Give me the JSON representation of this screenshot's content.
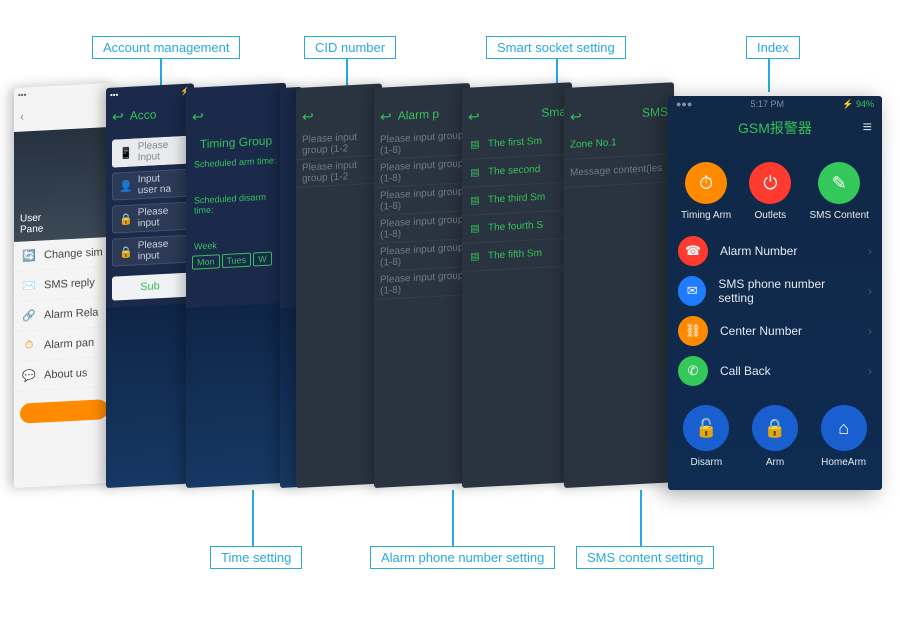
{
  "labels": {
    "top": [
      "Account management",
      "CID number",
      "Smart socket setting",
      "Index"
    ],
    "bottom": [
      "Time setting",
      "Alarm phone number setting",
      "SMS content setting"
    ]
  },
  "phone1_settings": {
    "hero_line1": "User",
    "hero_line2": "Pane",
    "items": [
      {
        "icon": "🔄",
        "color": "#ff8a00",
        "text": "Change sim"
      },
      {
        "icon": "✉️",
        "color": "#2aa9e0",
        "text": "SMS reply"
      },
      {
        "icon": "🔗",
        "color": "#ff8a00",
        "text": "Alarm Rela"
      },
      {
        "icon": "⏱",
        "color": "#ff8a00",
        "text": "Alarm pan"
      },
      {
        "icon": "💬",
        "color": "#2aa9e0",
        "text": "About us"
      }
    ]
  },
  "phone2_account": {
    "title": "Acco",
    "inputs": [
      {
        "icon": "📱",
        "ph": "Please Input"
      },
      {
        "icon": "👤",
        "ph": "Input user na"
      },
      {
        "icon": "🔒",
        "ph": "Please input"
      },
      {
        "icon": "🔒",
        "ph": "Please input"
      }
    ],
    "submit": "Sub"
  },
  "phone3_timing": {
    "title": "Timing Group",
    "arm_label": "Scheduled arm time:",
    "disarm_label": "Scheduled disarm time:",
    "week_label": "Week",
    "days": [
      "Mon",
      "Tues",
      "W"
    ]
  },
  "phone4_cid": {
    "placeholder": "Please input group (1-2"
  },
  "phone5_cid2": {
    "placeholder": "Please input group (1-8)"
  },
  "phone6_alarm": {
    "title": "Alarm p",
    "rows": [
      "Please input group (1-8)",
      "Please input group (1-8)",
      "Please input group (1-8)",
      "Please input group (1-8)",
      "Please input group (1-8)",
      "Please input group (1-8)"
    ]
  },
  "phone7_socket": {
    "title": "Sma",
    "rows": [
      "The first Sm",
      "The second",
      "The third Sm",
      "The fourth S",
      "The fifth Sm"
    ]
  },
  "phone8_sms": {
    "title": "SMS",
    "zone": "Zone No.1",
    "msg": "Message content(les"
  },
  "phone10_index": {
    "status": {
      "left": "●●●",
      "time": "5:17 PM",
      "batt": "94%"
    },
    "title": "GSM报警器",
    "top_circles": [
      {
        "cls": "c-or",
        "glyph": "⏱",
        "label": "Timing Arm"
      },
      {
        "cls": "c-rd",
        "glyph": "⏻",
        "label": "Outlets"
      },
      {
        "cls": "c-gr",
        "glyph": "✎",
        "label": "SMS Content"
      }
    ],
    "list": [
      {
        "cls": "c-rd",
        "glyph": "☎",
        "label": "Alarm Number"
      },
      {
        "cls": "c-bl",
        "glyph": "✉",
        "label": "SMS phone number setting"
      },
      {
        "cls": "c-or",
        "glyph": "⛓",
        "label": "Center Number"
      },
      {
        "cls": "c-gr",
        "glyph": "✆",
        "label": "Call Back"
      }
    ],
    "bottom_circles": [
      {
        "cls": "c-bl2",
        "glyph": "🔓",
        "label": "Disarm"
      },
      {
        "cls": "c-bl2",
        "glyph": "🔒",
        "label": "Arm"
      },
      {
        "cls": "c-bl2",
        "glyph": "⌂",
        "label": "HomeArm"
      }
    ]
  }
}
